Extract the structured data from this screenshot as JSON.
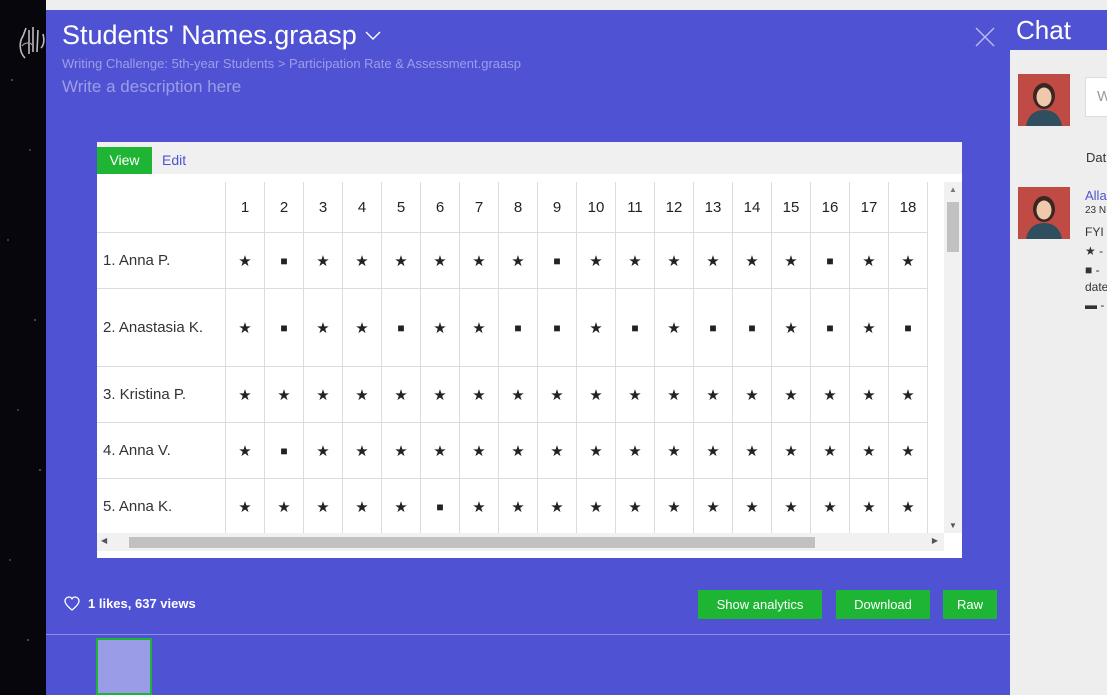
{
  "document": {
    "title": "Students' Names.graasp",
    "breadcrumb": "Writing Challenge: 5th-year Students > Participation Rate & Assessment.graasp",
    "description_placeholder": "Write a description here"
  },
  "tabs": {
    "view": "View",
    "edit": "Edit"
  },
  "table": {
    "columns": [
      "1",
      "2",
      "3",
      "4",
      "5",
      "6",
      "7",
      "8",
      "9",
      "10",
      "11",
      "12",
      "13",
      "14",
      "15",
      "16",
      "17",
      "18"
    ],
    "rows": [
      {
        "name": "1. Anna P.",
        "cells": [
          "★",
          "■",
          "★",
          "★",
          "★",
          "★",
          "★",
          "★",
          "■",
          "★",
          "★",
          "★",
          "★",
          "★",
          "★",
          "■",
          "★",
          "★"
        ]
      },
      {
        "name": "2. Anastasia K.",
        "cells": [
          "★",
          "■",
          "★",
          "★",
          "■",
          "★",
          "★",
          "■",
          "■",
          "★",
          "■",
          "★",
          "■",
          "■",
          "★",
          "■",
          "★",
          "■"
        ]
      },
      {
        "name": "3. Kristina P.",
        "cells": [
          "★",
          "★",
          "★",
          "★",
          "★",
          "★",
          "★",
          "★",
          "★",
          "★",
          "★",
          "★",
          "★",
          "★",
          "★",
          "★",
          "★",
          "★"
        ]
      },
      {
        "name": "4. Anna V.",
        "cells": [
          "★",
          "■",
          "★",
          "★",
          "★",
          "★",
          "★",
          "★",
          "★",
          "★",
          "★",
          "★",
          "★",
          "★",
          "★",
          "★",
          "★",
          "★"
        ]
      },
      {
        "name": "5. Anna K.",
        "cells": [
          "★",
          "★",
          "★",
          "★",
          "★",
          "■",
          "★",
          "★",
          "★",
          "★",
          "★",
          "★",
          "★",
          "★",
          "★",
          "★",
          "★",
          "★"
        ]
      }
    ]
  },
  "stats": {
    "text": "1 likes, 637 views"
  },
  "buttons": {
    "analytics": "Show analytics",
    "download": "Download",
    "raw": "Raw"
  },
  "chat": {
    "title": "Chat",
    "input_placeholder": "W",
    "date_text": "Dat",
    "message": {
      "author": "Alla",
      "time": "23 N",
      "line1": "FYI",
      "line2": "★ -",
      "line3": "■ -",
      "line4": "date",
      "line5": "▬ -"
    }
  },
  "colors": {
    "accent": "#5052d4",
    "success": "#1fb534",
    "muted_text": "#9b9ee6"
  }
}
